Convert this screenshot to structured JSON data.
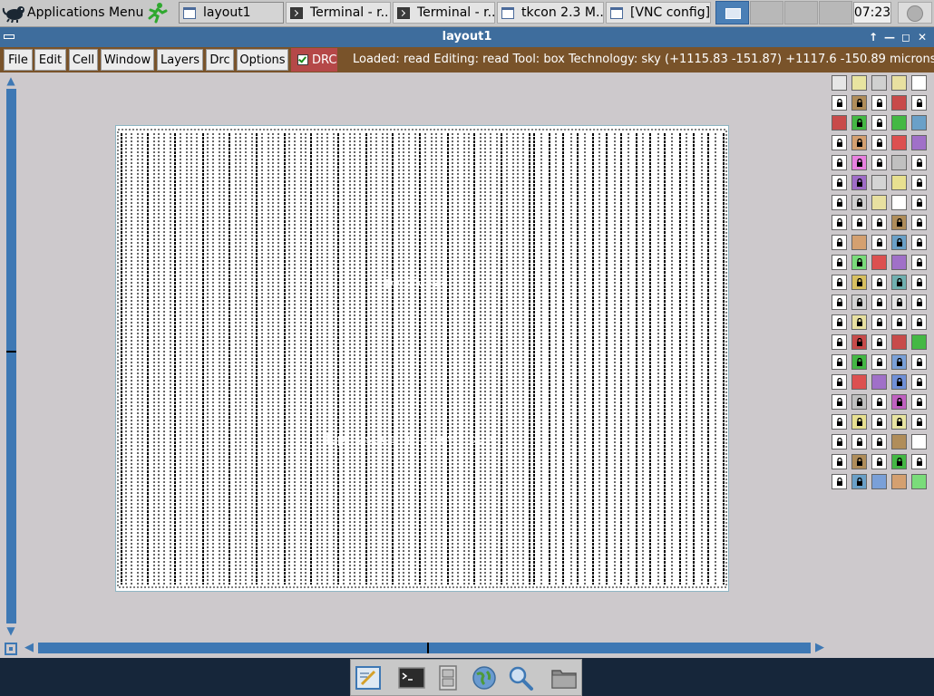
{
  "taskbar": {
    "app_menu_label": "Applications Menu",
    "tasks": [
      {
        "label": "layout1",
        "icon": "window-icon",
        "active": true
      },
      {
        "label": "Terminal - r...",
        "icon": "terminal-icon"
      },
      {
        "label": "Terminal - r...",
        "icon": "terminal-icon"
      },
      {
        "label": "tkcon 2.3 M...",
        "icon": "window-icon"
      },
      {
        "label": "[VNC config]",
        "icon": "window-icon"
      }
    ],
    "clock": "07:23"
  },
  "window": {
    "title": "layout1",
    "controls": [
      "↑",
      "—",
      "◻",
      "✕"
    ]
  },
  "menubar": {
    "items": [
      "File",
      "Edit",
      "Cell",
      "Window",
      "Layers",
      "Drc",
      "Options"
    ],
    "drc_label": "DRC",
    "drc_checked": true,
    "status": "Loaded: read Editing: read Tool: box  Technology: sky",
    "coords": "(+1115.83 -151.87) +1117.6 -150.89 microns"
  },
  "canvas": {
    "cell_name": "picorv32a",
    "cell_description": "Topmost cell in the window"
  },
  "palette": {
    "columns": 5,
    "rows": 21,
    "colors": {
      "background": "#ffffff",
      "lock": "#000000"
    }
  },
  "dock": {
    "items": [
      "text-editor-icon",
      "terminal-icon",
      "file-manager-icon",
      "web-browser-icon",
      "search-icon",
      "folder-icon"
    ]
  },
  "colors": {
    "titlebar": "#3e6d9d",
    "menubar": "#79532a",
    "drc": "#b54848",
    "scroll": "#3e78b4"
  }
}
